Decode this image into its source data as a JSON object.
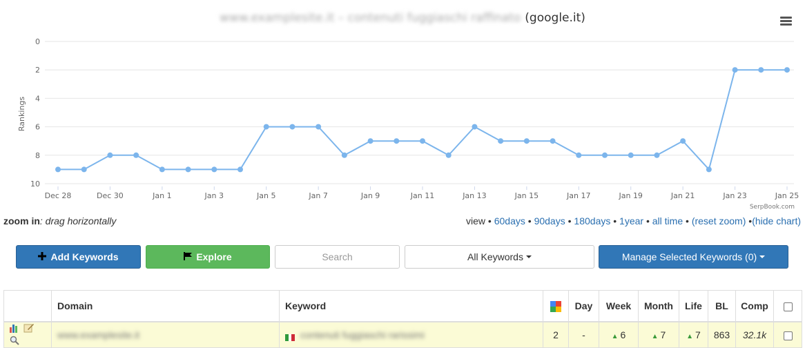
{
  "chart_title": {
    "site_blurred": "www.examplesite.it – contenuti fuggiaschi raffinato",
    "engine": "(google.it)"
  },
  "chart_data": {
    "type": "line",
    "ylabel": "Rankings",
    "ylim": [
      0,
      10
    ],
    "y_inverted": true,
    "y_ticks": [
      "0",
      "2",
      "4",
      "6",
      "8",
      "10"
    ],
    "x_tick_labels": [
      "Dec 28",
      "Dec 30",
      "Jan 1",
      "Jan 3",
      "Jan 5",
      "Jan 7",
      "Jan 9",
      "Jan 11",
      "Jan 13",
      "Jan 15",
      "Jan 17",
      "Jan 19",
      "Jan 21",
      "Jan 23",
      "Jan 25"
    ],
    "x": [
      "Dec 28",
      "Dec 29",
      "Dec 30",
      "Dec 31",
      "Jan 1",
      "Jan 2",
      "Jan 3",
      "Jan 4",
      "Jan 5",
      "Jan 6",
      "Jan 7",
      "Jan 8",
      "Jan 9",
      "Jan 10",
      "Jan 11",
      "Jan 12",
      "Jan 13",
      "Jan 14",
      "Jan 15",
      "Jan 16",
      "Jan 17",
      "Jan 18",
      "Jan 19",
      "Jan 20",
      "Jan 21",
      "Jan 22",
      "Jan 23",
      "Jan 24",
      "Jan 25"
    ],
    "values": [
      9,
      9,
      8,
      8,
      9,
      9,
      9,
      9,
      6,
      6,
      6,
      8,
      7,
      7,
      7,
      8,
      6,
      7,
      7,
      7,
      8,
      8,
      8,
      8,
      7,
      9,
      2,
      2,
      2
    ],
    "grid": true,
    "line_color": "#7cb5ec"
  },
  "credit": "SerpBook.com",
  "zoom_hint": {
    "label": "zoom in",
    "text": ": drag horizontally"
  },
  "view_links": {
    "prefix": "view •",
    "items": [
      "60days",
      "90days",
      "180days",
      "1year",
      "all time",
      "(reset zoom)",
      "(hide chart)"
    ]
  },
  "toolbar": {
    "add_label": "Add Keywords",
    "explore_label": "Explore",
    "search_placeholder": "Search",
    "all_keywords_label": "All Keywords",
    "manage_label": "Manage Selected Keywords (0)"
  },
  "table": {
    "headers": {
      "domain": "Domain",
      "keyword": "Keyword",
      "day": "Day",
      "week": "Week",
      "month": "Month",
      "life": "Life",
      "bl": "BL",
      "comp": "Comp"
    },
    "row": {
      "domain_blurred": "www.examplesite.it",
      "keyword_blurred": "contenuti fuggiaschi rarissimi",
      "rank": "2",
      "day": "-",
      "week": "6",
      "month": "7",
      "life": "7",
      "bl": "863",
      "comp": "32.1k"
    }
  },
  "colors": {
    "primary": "#3177b7",
    "success": "#5cb85c",
    "row_highlight": "#fbfbd6",
    "link": "#2a6fb0"
  }
}
